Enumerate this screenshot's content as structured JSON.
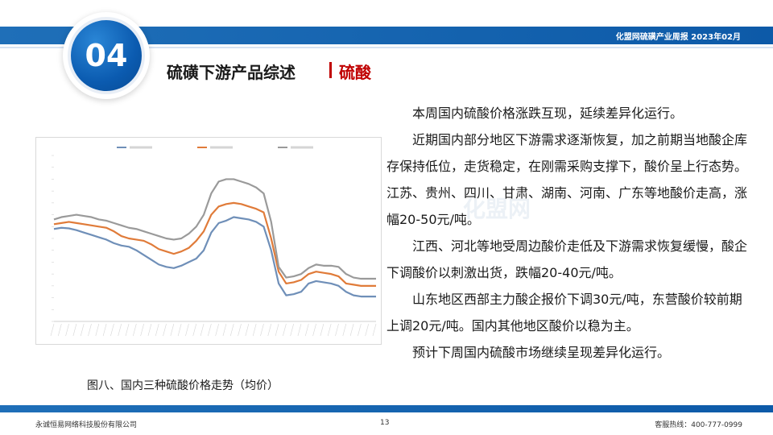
{
  "header": {
    "bar_text": "化盟网硫磺产业周报   2023年02月",
    "section_number": "04",
    "section_title": "硫磺下游产品综述",
    "section_subtitle": "硫酸"
  },
  "body": {
    "paragraphs": [
      "本周国内硫酸价格涨跌互现，延续差异化运行。",
      "近期国内部分地区下游需求逐渐恢复，加之前期当地酸企库存保持低位，走货稳定，在刚需采购支撑下，酸价呈上行态势。江苏、贵州、四川、甘肃、湖南、河南、广东等地酸价走高，涨幅20-50元/吨。",
      "江西、河北等地受周边酸价走低及下游需求恢复缓慢，酸企下调酸价以刺激出货，跌幅20-40元/吨。",
      "山东地区西部主力酸企报价下调30元/吨，东营酸价较前期上调20元/吨。国内其他地区酸价以稳为主。",
      "预计下周国内硫酸市场继续呈现差异化运行。"
    ],
    "watermark": "化盟网"
  },
  "chart_caption": "图八、国内三种硫酸价格走势（均价）",
  "chart_data": {
    "type": "line",
    "ylim": [
      0,
      1400
    ],
    "grid": false,
    "legend_position": "top",
    "series": [
      {
        "name": "",
        "color": "#6f8fb8",
        "values": [
          780,
          790,
          785,
          770,
          750,
          730,
          710,
          690,
          660,
          640,
          630,
          600,
          560,
          520,
          480,
          460,
          450,
          470,
          500,
          530,
          600,
          750,
          830,
          850,
          880,
          870,
          860,
          840,
          800,
          600,
          320,
          220,
          230,
          250,
          320,
          340,
          330,
          320,
          300,
          250,
          220,
          210,
          210,
          210
        ]
      },
      {
        "name": "",
        "color": "#e07b39",
        "values": [
          820,
          830,
          840,
          830,
          820,
          810,
          800,
          790,
          760,
          720,
          700,
          690,
          680,
          650,
          610,
          590,
          570,
          590,
          620,
          680,
          760,
          900,
          970,
          990,
          1000,
          990,
          970,
          950,
          920,
          700,
          420,
          320,
          330,
          350,
          400,
          420,
          410,
          400,
          380,
          320,
          310,
          300,
          300,
          300
        ]
      },
      {
        "name": "",
        "color": "#9a9a9a",
        "values": [
          860,
          880,
          890,
          900,
          890,
          880,
          860,
          850,
          830,
          810,
          790,
          780,
          760,
          740,
          720,
          700,
          690,
          700,
          740,
          800,
          900,
          1080,
          1180,
          1200,
          1200,
          1180,
          1160,
          1130,
          1080,
          840,
          460,
          370,
          380,
          400,
          450,
          480,
          470,
          470,
          460,
          400,
          370,
          360,
          360,
          360
        ]
      }
    ]
  },
  "footer": {
    "company": "永诚恒易网络科技股份有限公司",
    "page_number": "13",
    "hotline": "客服热线：400-777-0999"
  }
}
